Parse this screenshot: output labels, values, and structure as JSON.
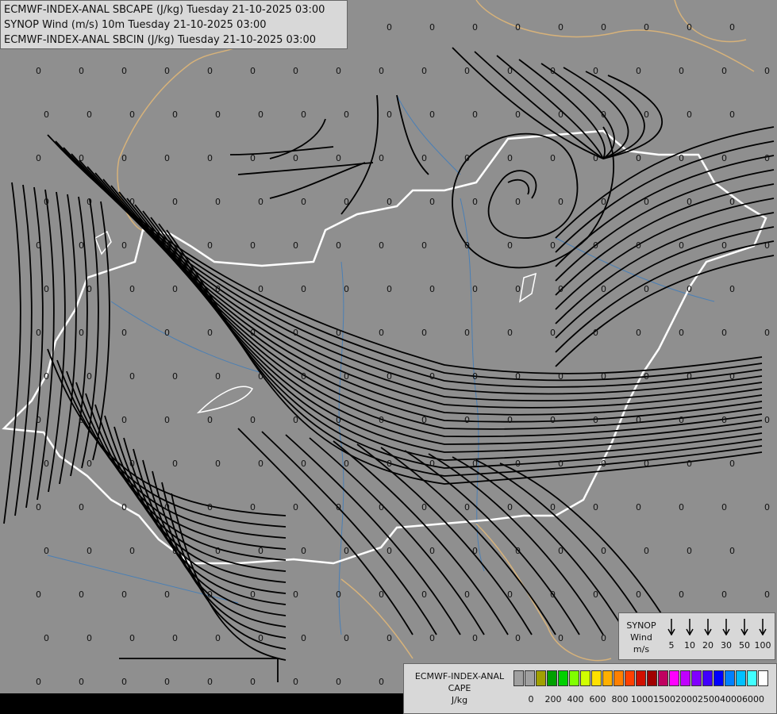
{
  "header": {
    "line1": "ECMWF-INDEX-ANAL SBCAPE (J/kg) Tuesday 21-10-2025 03:00",
    "line2": "SYNOP Wind (m/s) 10m Tuesday 21-10-2025 03:00",
    "line3": "ECMWF-INDEX-ANAL SBCIN (J/kg) Tuesday 21-10-2025 03:00"
  },
  "map": {
    "value_label": "0",
    "colors": {
      "background": "#8f8f8f",
      "border": "#ffffff",
      "neighbor_border": "#d7b27a",
      "river": "#4a7fb5",
      "streamline": "#000000"
    }
  },
  "wind_legend": {
    "title_lines": [
      "SYNOP",
      "Wind",
      "m/s"
    ],
    "speeds": [
      "5",
      "10",
      "20",
      "30",
      "50",
      "100"
    ]
  },
  "cape_legend": {
    "title_lines": [
      "ECMWF-INDEX-ANAL",
      "CAPE",
      "J/kg"
    ],
    "colors": [
      "#a0a0a0",
      "#a0a0a0",
      "#a0a000",
      "#00a000",
      "#00d000",
      "#80ff00",
      "#d0ff00",
      "#ffe000",
      "#ffb000",
      "#ff8000",
      "#ff4000",
      "#d01000",
      "#a00000",
      "#c00060",
      "#ff00ff",
      "#c000ff",
      "#8000ff",
      "#4000ff",
      "#0000ff",
      "#0080ff",
      "#00c0ff",
      "#40ffff",
      "#ffffff"
    ],
    "ticks": [
      "0",
      "200",
      "400",
      "600",
      "800",
      "1000",
      "1500",
      "2000",
      "2500",
      "4000",
      "6000"
    ]
  }
}
